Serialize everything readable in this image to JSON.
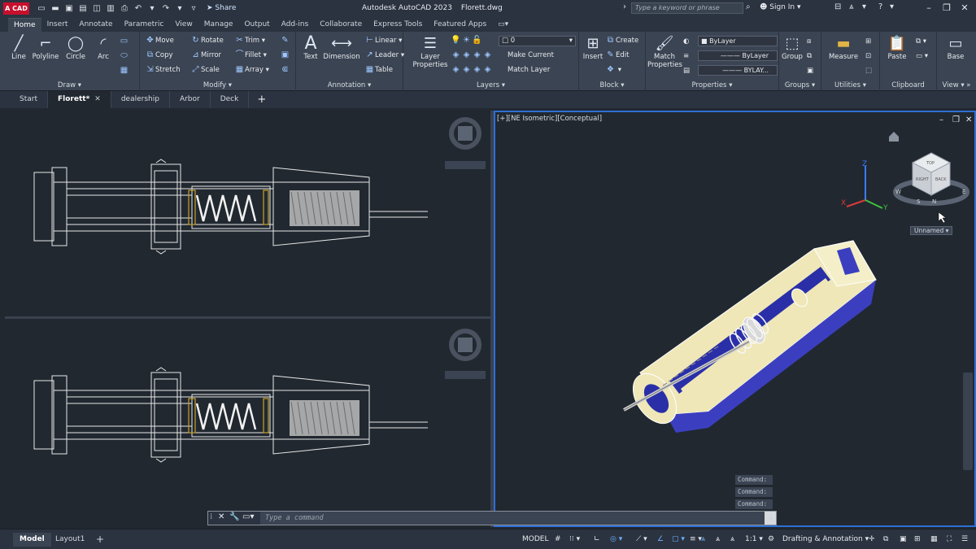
{
  "titlebar": {
    "logo": "A CAD",
    "share_label": "Share",
    "title": "Autodesk AutoCAD 2023",
    "filename": "Florett.dwg",
    "search_placeholder": "Type a keyword or phrase",
    "signin_label": "Sign In"
  },
  "ribbon_tabs": [
    "Home",
    "Insert",
    "Annotate",
    "Parametric",
    "View",
    "Manage",
    "Output",
    "Add-ins",
    "Collaborate",
    "Express Tools",
    "Featured Apps"
  ],
  "ribbon": {
    "draw": {
      "title": "Draw",
      "line": "Line",
      "polyline": "Polyline",
      "circle": "Circle",
      "arc": "Arc"
    },
    "modify": {
      "title": "Modify",
      "move": "Move",
      "rotate": "Rotate",
      "trim": "Trim",
      "copy": "Copy",
      "mirror": "Mirror",
      "fillet": "Fillet",
      "stretch": "Stretch",
      "scale": "Scale",
      "array": "Array"
    },
    "annotation": {
      "title": "Annotation",
      "text": "Text",
      "dimension": "Dimension",
      "linear": "Linear",
      "leader": "Leader",
      "table": "Table"
    },
    "layers": {
      "title": "Layers",
      "layer_properties": "Layer Properties",
      "current_layer": "0",
      "make_current": "Make Current",
      "match_layer": "Match Layer"
    },
    "block": {
      "title": "Block",
      "insert": "Insert",
      "create": "Create",
      "edit": "Edit"
    },
    "properties": {
      "title": "Properties",
      "match_properties": "Match Properties",
      "color": "ByLayer",
      "linetype": "ByLayer",
      "lineweight": "BYLAY..."
    },
    "groups": {
      "title": "Groups",
      "group": "Group"
    },
    "utilities": {
      "title": "Utilities",
      "measure": "Measure"
    },
    "clipboard": {
      "title": "Clipboard",
      "paste": "Paste"
    },
    "view": {
      "title": "View",
      "base": "Base"
    }
  },
  "file_tabs": [
    {
      "label": "Start"
    },
    {
      "label": "Florett*"
    },
    {
      "label": "dealership"
    },
    {
      "label": "Arbor"
    },
    {
      "label": "Deck"
    }
  ],
  "viewport_right": {
    "label": "[+][NE Isometric][Conceptual]",
    "viewcube_name": "Unnamed",
    "cube_faces": [
      "TOP",
      "RIGHT",
      "BACK"
    ],
    "compass": [
      "N",
      "E",
      "S",
      "W"
    ]
  },
  "command_history": [
    "Command:",
    "Command:",
    "Command:"
  ],
  "command_line": {
    "placeholder": "Type a command"
  },
  "statusbar": {
    "model_tab": "Model",
    "layout_tab": "Layout1",
    "model_label": "MODEL",
    "scale": "1:1",
    "workspace": "Drafting & Annotation"
  },
  "colors": {
    "accent": "#2f6fd6",
    "app_logo": "#c8102e",
    "cream": "#efe7b8",
    "blue_fill": "#3b3fbf",
    "wire": "#e8e8e8",
    "spring_yellow": "#c9a227"
  }
}
